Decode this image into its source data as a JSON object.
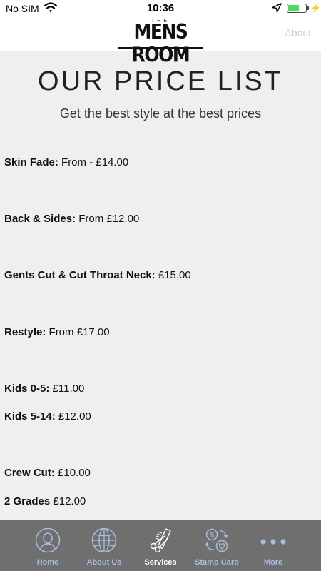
{
  "status_bar": {
    "carrier": "No SIM",
    "time": "10:36",
    "battery_level": 0.65,
    "icons": [
      "wifi-icon",
      "location-arrow-icon",
      "battery-icon",
      "charging-bolt-icon"
    ]
  },
  "header": {
    "logo_top": "THE",
    "logo_main": "MENS ROOM",
    "right_link": "About"
  },
  "page": {
    "title": "OUR PRICE LIST",
    "subtitle": "Get the best style at the best prices"
  },
  "prices": [
    {
      "name": "Skin Fade:",
      "detail": " From - £14.00"
    },
    {
      "name": "Back & Sides:",
      "detail": " From £12.00"
    },
    {
      "name": "Gents Cut & Cut Throat Neck:",
      "detail": " £15.00"
    },
    {
      "name": "Restyle:",
      "detail": " From £17.00"
    },
    {
      "name": "Kids 0-5:",
      "detail": " £11.00"
    },
    {
      "name": "Kids 5-14:",
      "detail": " £12.00"
    },
    {
      "name": "Crew Cut:",
      "detail": " £10.00"
    },
    {
      "name": "2 Grades",
      "detail": " £12.00"
    }
  ],
  "tab_bar": {
    "tabs": [
      {
        "label": "Home",
        "icon": "person-icon",
        "active": false
      },
      {
        "label": "About Us",
        "icon": "globe-icon",
        "active": false
      },
      {
        "label": "Services",
        "icon": "scissors-comb-icon",
        "active": true
      },
      {
        "label": "Stamp Card",
        "icon": "stamp-card-icon",
        "active": false
      },
      {
        "label": "More",
        "icon": "more-dots-icon",
        "active": false
      }
    ]
  },
  "colors": {
    "background": "#efefef",
    "tab_bar": "#6f6f6f",
    "tab_inactive": "#a9bedc",
    "tab_active": "#ffffff",
    "battery": "#4cd964"
  }
}
